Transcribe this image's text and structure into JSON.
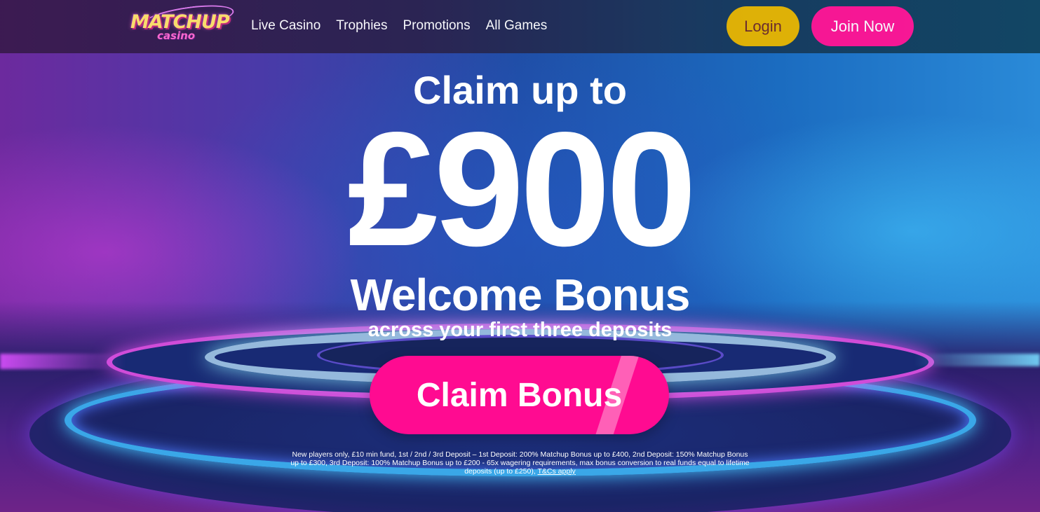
{
  "brand": {
    "logo_main": "MATCHUP",
    "logo_sub": "casino"
  },
  "nav": {
    "items": [
      {
        "label": "Live Casino"
      },
      {
        "label": "Trophies"
      },
      {
        "label": "Promotions"
      },
      {
        "label": "All Games"
      }
    ]
  },
  "header": {
    "login_label": "Login",
    "join_label": "Join Now"
  },
  "hero": {
    "claim_up_to": "Claim up to",
    "amount": "£900",
    "welcome": "Welcome Bonus",
    "subtitle": "across your first three deposits",
    "cta_label": "Claim Bonus",
    "terms_text": "New players only, £10 min fund, 1st / 2nd / 3rd Deposit – 1st Deposit: 200% Matchup Bonus up to £400, 2nd Deposit: 150% Matchup Bonus up to £300, 3rd Deposit: 100% Matchup Bonus up to £200 - 65x wagering requirements, max bonus conversion to real funds equal to lifetime deposits (up to £250),",
    "terms_link": "T&Cs apply"
  },
  "colors": {
    "login_button": "#e6b400",
    "join_button": "#ff1493",
    "cta_button": "#ff0b91"
  }
}
